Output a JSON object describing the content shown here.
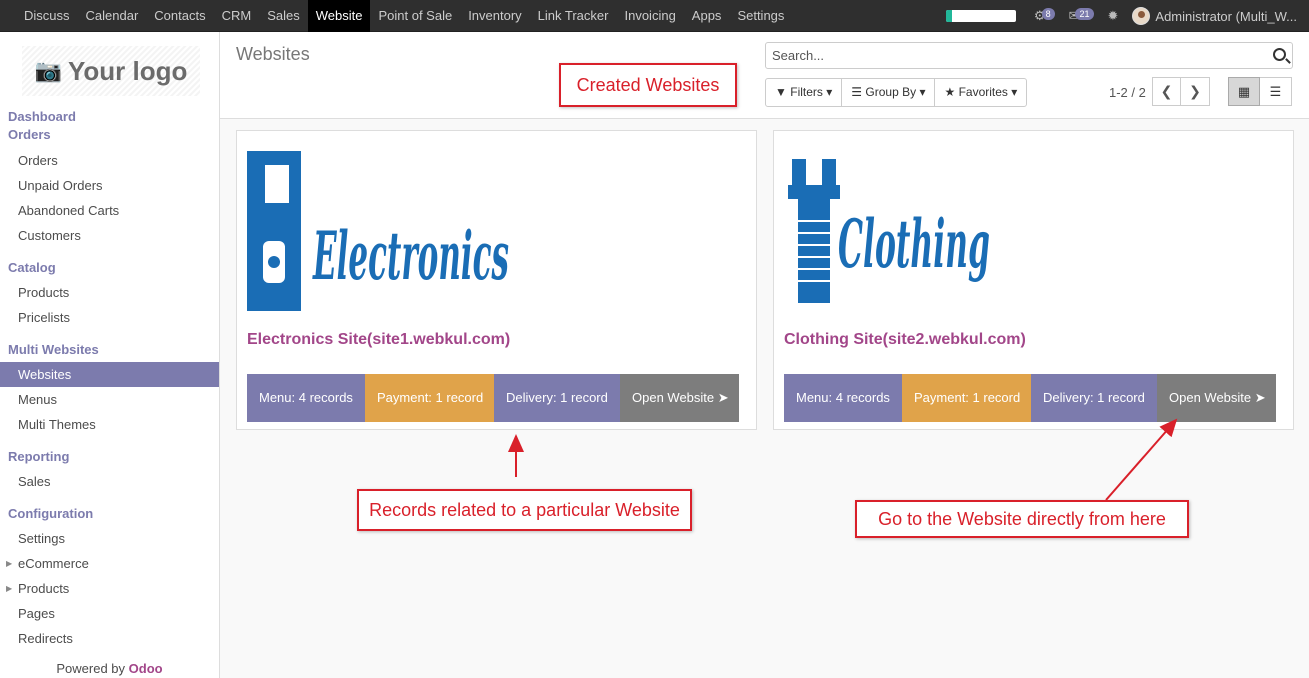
{
  "topbar": {
    "menu": [
      "Discuss",
      "Calendar",
      "Contacts",
      "CRM",
      "Sales",
      "Website",
      "Point of Sale",
      "Inventory",
      "Link Tracker",
      "Invoicing",
      "Apps",
      "Settings"
    ],
    "active": "Website",
    "progress": 0.08,
    "chat_count": "8",
    "message_count": "21",
    "user": "Administrator (Multi_W..."
  },
  "sidebar": {
    "logo_text": "Your logo",
    "sections": [
      {
        "header": "Dashboard",
        "items": []
      },
      {
        "header": "Orders",
        "items": [
          "Orders",
          "Unpaid Orders",
          "Abandoned Carts",
          "Customers"
        ]
      },
      {
        "header": "Catalog",
        "items": [
          "Products",
          "Pricelists"
        ]
      },
      {
        "header": "Multi Websites",
        "items": [
          "Websites",
          "Menus",
          "Multi Themes"
        ]
      },
      {
        "header": "Reporting",
        "items": [
          "Sales"
        ]
      },
      {
        "header": "Configuration",
        "items": [
          "Settings",
          "eCommerce",
          "Products",
          "Pages",
          "Redirects"
        ]
      }
    ],
    "active_item": "Websites",
    "collapsible_items": [
      "eCommerce",
      "Products"
    ],
    "powered_by": "Powered by",
    "powered_brand": "Odoo"
  },
  "control_panel": {
    "breadcrumb": "Websites",
    "search_placeholder": "Search...",
    "filters_label": "Filters",
    "group_by_label": "Group By",
    "favorites_label": "Favorites",
    "pager": "1-2 / 2"
  },
  "cards": [
    {
      "logo_text": "Electronics",
      "title": "Electronics Site(site1.webkul.com)",
      "menu": "Menu: 4 records",
      "payment": "Payment: 1 record",
      "delivery": "Delivery: 1 record",
      "open": "Open Website"
    },
    {
      "logo_text": "Clothing",
      "title": "Clothing Site(site2.webkul.com)",
      "menu": "Menu: 4 records",
      "payment": "Payment: 1 record",
      "delivery": "Delivery: 1 record",
      "open": "Open Website"
    }
  ],
  "annotations": {
    "created": "Created Websites",
    "records": "Records related to a particular Website",
    "goto": "Go to the Website directly from here"
  },
  "colors": {
    "menu_bg": "#7c7bad",
    "payment_bg": "#e0a34a",
    "delivery_bg": "#7c7bad",
    "open_bg": "#7d7d7d",
    "logo_blue": "#1a6db5",
    "annotation_red": "#d9202a"
  }
}
